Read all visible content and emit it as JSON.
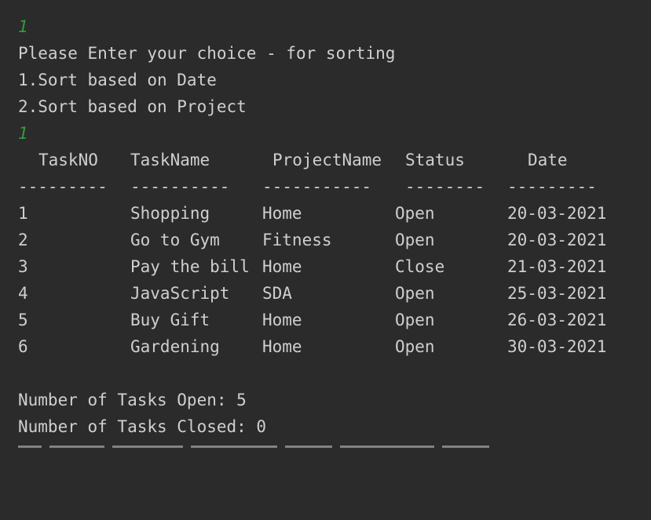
{
  "console": {
    "input1": "1",
    "prompt": "Please Enter your choice - for sorting",
    "option1": "1.Sort based on Date",
    "option2": "2.Sort based on Project",
    "input2": "1"
  },
  "table": {
    "headers": [
      "TaskNO",
      "TaskName",
      "ProjectName",
      "Status",
      "Date"
    ],
    "separators": [
      "---------",
      "----------",
      "-----------",
      "--------",
      "---------"
    ],
    "rows": [
      [
        "1",
        "Shopping",
        "Home",
        "Open",
        "20-03-2021"
      ],
      [
        "2",
        "Go to Gym",
        "Fitness",
        "Open",
        "20-03-2021"
      ],
      [
        "3",
        "Pay the bill",
        "Home",
        "Close",
        "21-03-2021"
      ],
      [
        "4",
        "JavaScript",
        "SDA",
        "Open",
        "25-03-2021"
      ],
      [
        "5",
        "Buy Gift",
        "Home",
        "Open",
        "26-03-2021"
      ],
      [
        "6",
        "Gardening",
        "Home",
        "Open",
        "30-03-2021"
      ]
    ]
  },
  "summary": {
    "open": "Number of Tasks Open: 5",
    "closed": "Number of Tasks Closed: 0"
  },
  "colors": {
    "background": "#2b2b2b",
    "text": "#cfcfcf",
    "user_input": "#2f9c3a"
  }
}
